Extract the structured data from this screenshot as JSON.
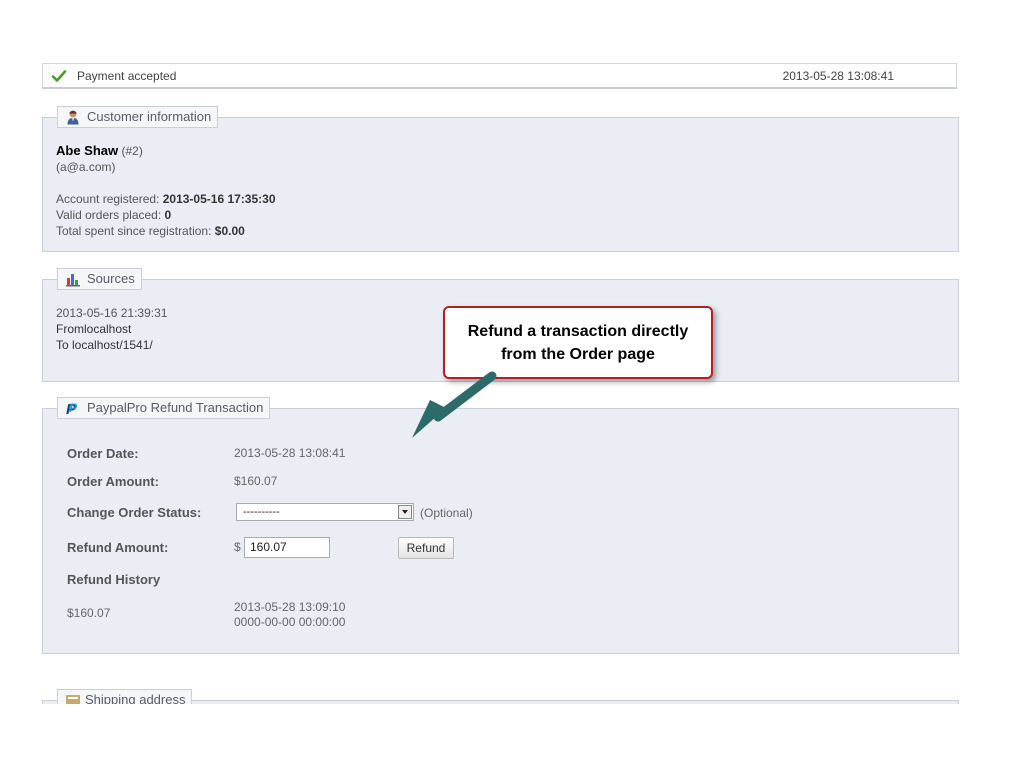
{
  "status": {
    "label": "Payment accepted",
    "date": "2013-05-28 13:08:41",
    "icon": "check-icon",
    "icon_color": "#4a9d2a"
  },
  "customer": {
    "legend": "Customer information",
    "name": "Abe Shaw",
    "id": "(#2)",
    "email": "(a@a.com)",
    "registered_label": "Account registered:",
    "registered_value": "2013-05-16 17:35:30",
    "orders_label": "Valid orders placed:",
    "orders_value": "0",
    "spent_label": "Total spent since registration:",
    "spent_value": "$0.00"
  },
  "sources": {
    "legend": "Sources",
    "date": "2013-05-16 21:39:31",
    "from": "Fromlocalhost",
    "to": "To localhost/1541/"
  },
  "callout": {
    "line1": "Refund a transaction directly",
    "line2": "from the Order page",
    "border_color": "#b51f24",
    "arrow_color": "#2d6b6a"
  },
  "paypal": {
    "legend": "PaypalPro Refund Transaction",
    "order_date_label": "Order Date:",
    "order_date_value": "2013-05-28 13:08:41",
    "order_amount_label": "Order Amount:",
    "order_amount_value": "$160.07",
    "status_label": "Change Order Status:",
    "status_selected": "----------",
    "status_hint": "(Optional)",
    "refund_label": "Refund Amount:",
    "currency": "$",
    "refund_value": "160.07",
    "refund_button": "Refund",
    "history_label": "Refund History",
    "history_amount": "$160.07",
    "history_date1": "2013-05-28 13:09:10",
    "history_date2": "0000-00-00 00:00:00"
  },
  "shipping": {
    "legend": "Shipping address"
  }
}
